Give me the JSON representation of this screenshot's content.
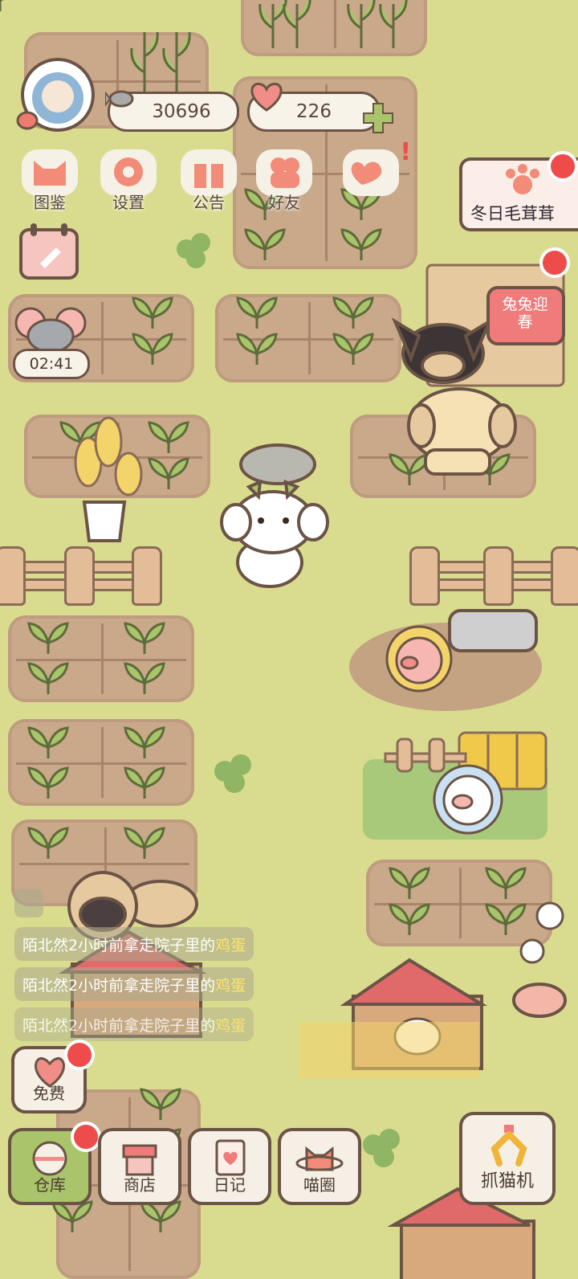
{
  "hud": {
    "coins": "30696",
    "hearts": "226"
  },
  "top_menu": [
    {
      "label": "图鉴",
      "icon": "cat-head-icon"
    },
    {
      "label": "设置",
      "icon": "gear-icon"
    },
    {
      "label": "公告",
      "icon": "gift-icon"
    },
    {
      "label": "好友",
      "icon": "friends-icon"
    },
    {
      "label": "",
      "icon": "hearts-icon"
    }
  ],
  "events": {
    "winter_label": "冬日毛茸茸",
    "rabbit_label": "兔兔迎春"
  },
  "timer": "02:41",
  "notices": [
    {
      "prefix": "陌北然2小时前拿走院子里的",
      "item": "鸡蛋"
    },
    {
      "prefix": "陌北然2小时前拿走院子里的",
      "item": "鸡蛋"
    },
    {
      "prefix": "陌北然2小时前拿走院子里的",
      "item": "鸡蛋"
    }
  ],
  "free_button": "免费",
  "bottom_bar": {
    "warehouse": "仓库",
    "shop": "商店",
    "diary": "日记",
    "meow_circle": "喵圈",
    "claw_machine": "抓猫机"
  },
  "colors": {
    "grass": "#d9dc8f",
    "soil": "#c9a98a",
    "badge_red": "#ee4b4b",
    "highlight": "#ffe46b"
  }
}
